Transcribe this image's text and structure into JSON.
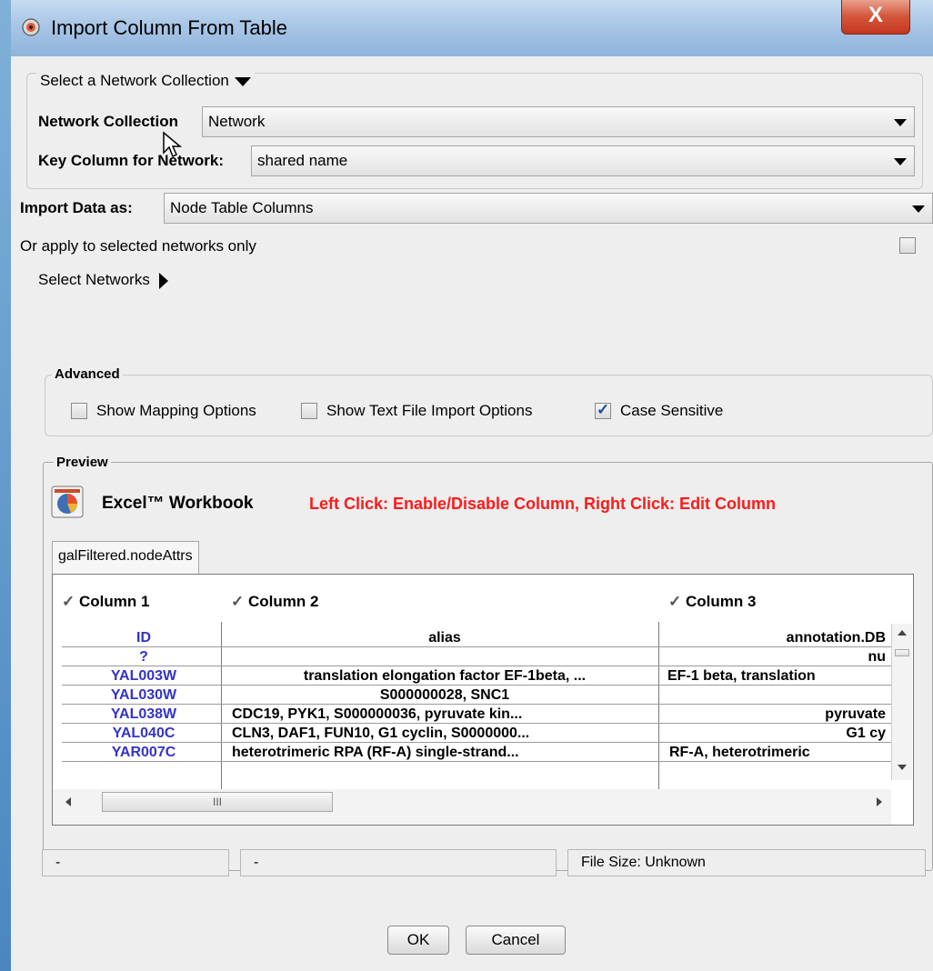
{
  "window": {
    "title": "Import Column From Table",
    "close_glyph": "X"
  },
  "network_collection_group": {
    "toggle_label": "Select a Network Collection",
    "collection_label": "Network Collection",
    "collection_value": "Network",
    "key_column_label": "Key Column for Network:",
    "key_column_value": "shared name"
  },
  "import_as": {
    "label": "Import Data as:",
    "value": "Node Table Columns"
  },
  "apply_selected": {
    "label": "Or apply to selected networks only",
    "checked": false
  },
  "select_networks": {
    "label": "Select Networks"
  },
  "advanced": {
    "title": "Advanced",
    "options": [
      {
        "label": "Show Mapping Options",
        "checked": false
      },
      {
        "label": "Show Text File Import Options",
        "checked": false
      },
      {
        "label": "Case Sensitive",
        "checked": true
      }
    ]
  },
  "preview": {
    "title": "Preview",
    "source_type": "Excel™ Workbook",
    "hint": "Left Click: Enable/Disable Column, Right Click: Edit Column",
    "tab": "galFiltered.nodeAttrs",
    "column_headers": [
      "Column 1",
      "Column 2",
      "Column 3"
    ],
    "field_names": [
      "ID",
      "alias",
      "annotation.DB"
    ],
    "rows": [
      [
        "?",
        "",
        "nu"
      ],
      [
        "YAL003W",
        "translation elongation factor EF-1beta, ...",
        "EF-1 beta, translation"
      ],
      [
        "YAL030W",
        "S000000028, SNC1",
        ""
      ],
      [
        "YAL038W",
        "CDC19, PYK1, S000000036, pyruvate kin...",
        "pyruvate"
      ],
      [
        "YAL040C",
        "CLN3, DAF1, FUN10, G1 cyclin, S0000000...",
        "G1 cy"
      ],
      [
        "YAR007C",
        "heterotrimeric RPA (RF-A) single-strand...",
        "RF-A, heterotrimeric"
      ]
    ],
    "hscroll_grip": "III"
  },
  "status_bar": [
    "-",
    "-",
    "File Size: Unknown"
  ],
  "buttons": {
    "ok": "OK",
    "cancel": "Cancel"
  },
  "colors": {
    "hint": "#ff1a1a",
    "id_column": "#3333cc",
    "check_glyph": "✓"
  }
}
